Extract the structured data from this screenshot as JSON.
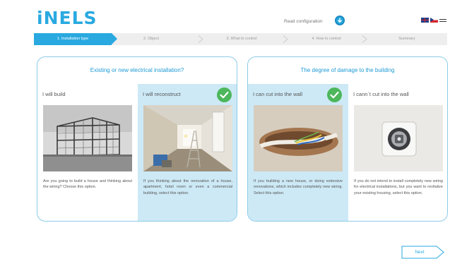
{
  "header": {
    "logo": "iNELS",
    "read_configuration": "Read configuration",
    "read_configuration_icon": "download-arrow-icon",
    "languages": [
      "English",
      "Czech"
    ]
  },
  "steps": [
    {
      "label": "1. Installation type",
      "active": true
    },
    {
      "label": "2. Object",
      "active": false
    },
    {
      "label": "3. What to control",
      "active": false
    },
    {
      "label": "4. How to control",
      "active": false
    },
    {
      "label": "Summary",
      "active": false
    }
  ],
  "panels": {
    "left": {
      "title": "Existing or new electrical installation?",
      "options": [
        {
          "title": "I will build",
          "selected": false,
          "text": "Are you going to build a house and thinking about the wiring? Choose this option."
        },
        {
          "title": "I will reconstruct",
          "selected": true,
          "text": "If you thinking about the renovation of a house, apartment, hotel room or even a commercial building, select this option."
        }
      ]
    },
    "right": {
      "title": "The degree of damage to the building",
      "options": [
        {
          "title": "I can cut into the wall",
          "selected": true,
          "text": "If you building a new house, or doing extensive renovations, which includes completely new wiring. Select this option."
        },
        {
          "title": "I cann´t cut into the wall",
          "selected": false,
          "text": "If you do not intend to install completely new wiring for electrical installations, but you want to revitalize your existing housing, select this option."
        }
      ]
    }
  },
  "footer": {
    "next_label": "Next"
  },
  "colors": {
    "accent": "#29a9e0",
    "selected_bg": "#cde9f6",
    "check": "#4cb75b",
    "panel_border": "#8ccbe8"
  }
}
